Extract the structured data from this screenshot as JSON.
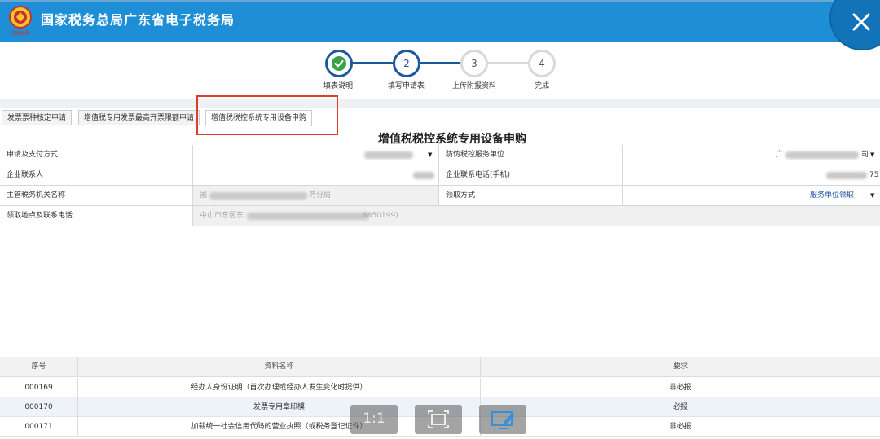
{
  "header": {
    "title": "国家税务总局广东省电子税务局",
    "emblem_text": "中国税务",
    "close_icon": "close-icon"
  },
  "stepper": {
    "steps": [
      {
        "num": "",
        "label": "填表说明",
        "state": "done"
      },
      {
        "num": "2",
        "label": "填写申请表",
        "state": "active"
      },
      {
        "num": "3",
        "label": "上传附报资料",
        "state": "pending"
      },
      {
        "num": "4",
        "label": "完成",
        "state": "pending"
      }
    ]
  },
  "tabs": [
    {
      "label": "发票票种核定申请"
    },
    {
      "label": "增值税专用发票最高开票限额申请"
    },
    {
      "label": "增值税税控系统专用设备申购"
    }
  ],
  "form": {
    "title": "增值税税控系统专用设备申购",
    "apply_pay_label": "申请及支付方式",
    "anti_fake_label": "防伪税控服务单位",
    "anti_fake_value": "广",
    "anti_fake_value_end": "司",
    "contact_label": "企业联系人",
    "phone_label": "企业联系电话(手机)",
    "phone_value_end": "75",
    "tax_org_label": "主管税务机关名称",
    "tax_org_value_start": "国",
    "tax_org_value_end": "务分局",
    "receive_method_label": "领取方式",
    "receive_method_value": "服务单位领取",
    "pickup_label": "领取地点及联系电话",
    "pickup_value_start": "中山市东区东",
    "pickup_value_end": "8850199)"
  },
  "table": {
    "headers": [
      "序号",
      "资料名称",
      "要求"
    ],
    "rows": [
      [
        "000169",
        "经办人身份证明（首次办理或经办人发生变化时提供）",
        "非必报"
      ],
      [
        "000170",
        "发票专用章印模",
        "必报"
      ],
      [
        "000171",
        "加载统一社会信用代码的营业执照（或税务登记证件）",
        "非必报"
      ]
    ]
  },
  "viewer_toolbar": {
    "ratio_label": "1:1",
    "fit_icon": "fit-screen-icon",
    "edit_icon": "screen-edit-icon"
  },
  "colors": {
    "header_blue": "#1e8fd6",
    "step_blue": "#1a5a9c",
    "highlight_red": "#e03b2f",
    "link_blue": "#1a53a0"
  }
}
